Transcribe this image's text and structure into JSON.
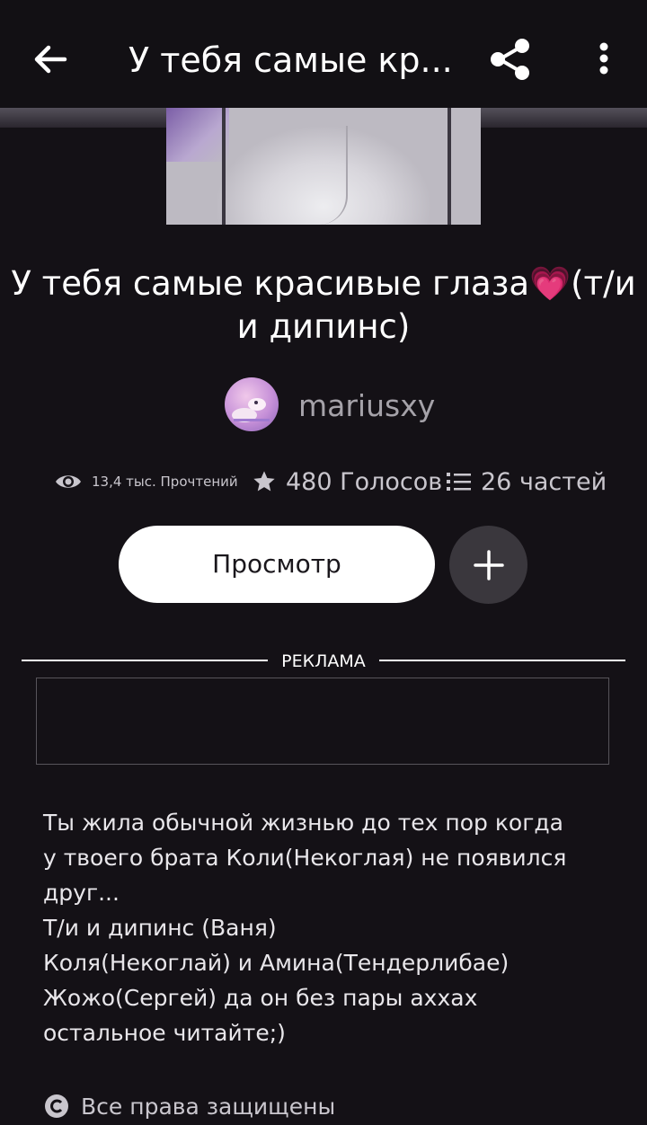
{
  "topbar": {
    "title": "У тебя самые кр...",
    "icons": {
      "back": "back-arrow-icon",
      "share": "share-icon",
      "more": "more-vertical-icon"
    }
  },
  "story": {
    "title": "У тебя самые красивые глаза💗(т/и и дипинс)",
    "author": "mariusxy",
    "stats": {
      "reads": "13,4 тыс. Прочтений",
      "votes": "480 Голосов",
      "parts": "26 частей"
    }
  },
  "actions": {
    "view_label": "Просмотр",
    "add_icon": "plus-icon"
  },
  "ad": {
    "label": "РЕКЛАМА"
  },
  "description": {
    "lines": [
      "Ты жила обычной жизнью до тех пор когда",
      "у твоего брата Коли(Некоглая) не появился",
      "друг...",
      "Т/и и дипинс (Ваня)",
      "Коля(Некоглай) и Амина(Тендерлибае)",
      "Жожо(Сергей) да он без пары аххах",
      "остальное читайте;)"
    ]
  },
  "rights": {
    "text": "Все права защищены",
    "icon": "copyright-icon"
  },
  "colors": {
    "background": "#141116",
    "topbar": "#121014",
    "button_primary": "#ffffff",
    "button_secondary": "#3a373d",
    "muted_text": "#a5a2a9"
  }
}
